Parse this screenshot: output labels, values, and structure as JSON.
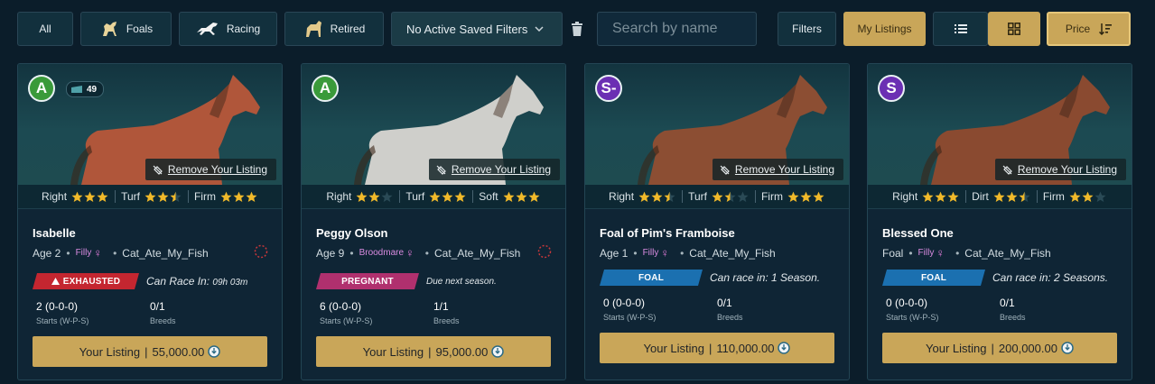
{
  "toolbar": {
    "all": "All",
    "foals": "Foals",
    "racing": "Racing",
    "retired": "Retired",
    "saved_filters": "No Active Saved Filters",
    "search_placeholder": "Search by name",
    "filters": "Filters",
    "my_listings": "My Listings",
    "price": "Price"
  },
  "colors": {
    "gold": "#c9a659",
    "background": "#0b1d2a",
    "exhausted": "#c42630",
    "pregnant": "#b0306e",
    "foal": "#1b70b0"
  },
  "cards": [
    {
      "grade": "A",
      "level": "49",
      "coat": "#b0563a",
      "remove": "Remove Your Listing",
      "prefs": [
        {
          "label": "Right",
          "stars": 3
        },
        {
          "label": "Turf",
          "stars": 2.5
        },
        {
          "label": "Firm",
          "stars": 3
        }
      ],
      "name": "Isabelle",
      "age": "Age 2",
      "sex": "Filly",
      "owner": "Cat_Ate_My_Fish",
      "tag": "EXHAUSTED",
      "status_label": "Can Race In:",
      "status_value": "09h 03m",
      "record": "2 (0-0-0)",
      "record_label": "Starts (W-P-S)",
      "breeds": "0/1",
      "breeds_label": "Breeds",
      "buy_label": "Your Listing",
      "price": "55,000.00"
    },
    {
      "grade": "A",
      "coat": "#cfcfcb",
      "remove": "Remove Your Listing",
      "prefs": [
        {
          "label": "Right",
          "stars": 2
        },
        {
          "label": "Turf",
          "stars": 3
        },
        {
          "label": "Soft",
          "stars": 3
        }
      ],
      "name": "Peggy Olson",
      "age": "Age 9",
      "sex": "Broodmare",
      "owner": "Cat_Ate_My_Fish",
      "tag": "PREGNANT",
      "status_label": "Due next season.",
      "status_value": "",
      "record": "6 (0-0-0)",
      "record_label": "Starts (W-P-S)",
      "breeds": "1/1",
      "breeds_label": "Breeds",
      "buy_label": "Your Listing",
      "price": "95,000.00"
    },
    {
      "grade": "S-",
      "coat": "#8c4e33",
      "remove": "Remove Your Listing",
      "prefs": [
        {
          "label": "Right",
          "stars": 2.5
        },
        {
          "label": "Turf",
          "stars": 1.5
        },
        {
          "label": "Firm",
          "stars": 3
        }
      ],
      "name": "Foal of Pim's Framboise",
      "age": "Age 1",
      "sex": "Filly",
      "owner": "Cat_Ate_My_Fish",
      "tag": "FOAL",
      "status_label": "Can race in:",
      "status_value": "1 Season.",
      "record": "0 (0-0-0)",
      "record_label": "Starts (W-P-S)",
      "breeds": "0/1",
      "breeds_label": "Breeds",
      "buy_label": "Your Listing",
      "price": "110,000.00"
    },
    {
      "grade": "S",
      "coat": "#8a4a30",
      "remove": "Remove Your Listing",
      "prefs": [
        {
          "label": "Right",
          "stars": 3
        },
        {
          "label": "Dirt",
          "stars": 2.5
        },
        {
          "label": "Firm",
          "stars": 2
        }
      ],
      "name": "Blessed One",
      "age": "Foal",
      "sex": "Filly",
      "owner": "Cat_Ate_My_Fish",
      "tag": "FOAL",
      "status_label": "Can race in:",
      "status_value": "2 Seasons.",
      "record": "0 (0-0-0)",
      "record_label": "Starts (W-P-S)",
      "breeds": "0/1",
      "breeds_label": "Breeds",
      "buy_label": "Your Listing",
      "price": "200,000.00"
    }
  ]
}
